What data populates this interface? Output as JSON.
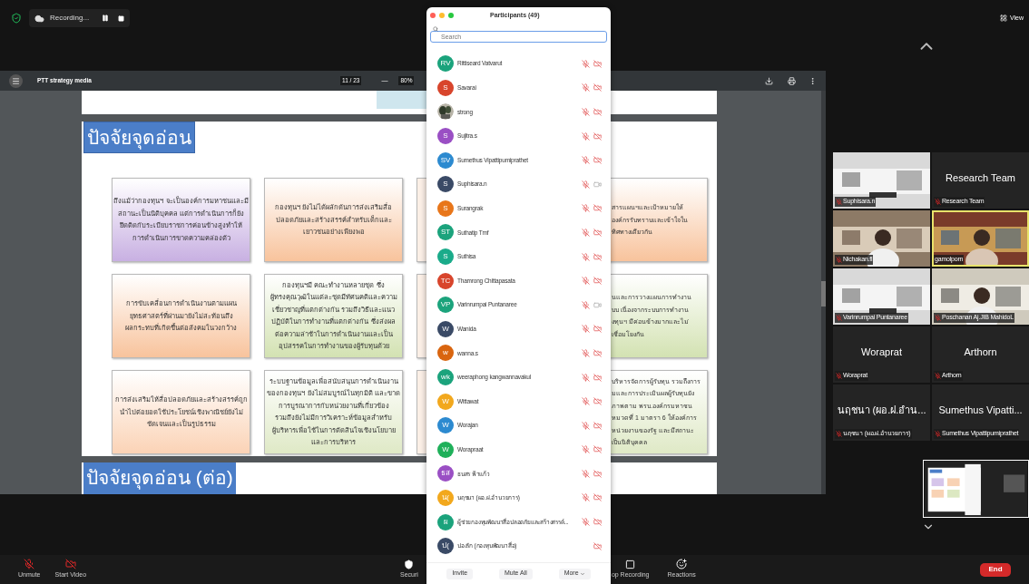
{
  "top_bar": {
    "recording_label": "Recording...",
    "view_label": "View"
  },
  "viewer": {
    "document_title": "PTT strategy media",
    "page_counter": "11 / 23",
    "zoom_out": "—",
    "zoom": "80%"
  },
  "slides": [
    {
      "title": "ปัจจัยจุดอ่อน",
      "cards": [
        {
          "kind": "full",
          "color": "#c8b0e2",
          "lines": [
            "ถึงแม้ว่ากองทุนฯ จะเป็นองค์การมหาชนและมี",
            "สถานะเป็นนิติบุคคล แต่การดำเนินการก็ยัง",
            "ยึดติดกับระเบียบราชการค่อนข้างสูงทำให้",
            "การดำเนินการขาดความคล่องตัว"
          ]
        },
        {
          "kind": "full",
          "color": "#f8c39c",
          "lines": [
            "กองทุนฯ ยังไม่ได้ผลักดันการส่งเสริมสื่อ",
            "ปลอดภัยและสร้างสรรค์สำหรับเด็กและ",
            "เยาวชนอย่างเพียงพอ"
          ]
        },
        {
          "kind": "sliver"
        },
        {
          "kind": "cut",
          "color": "#f8c39c",
          "lines": [
            "สารแผนฯและเป้าหมายให้",
            "องค์กรรับทราบและเข้าใจใน",
            "ทิศทางเดียวกัน"
          ]
        },
        {
          "kind": "full",
          "color": "#f8c39c",
          "lines": [
            "การขับเคลื่อนการดำเนินงานตามแผน",
            "ยุทธศาสตร์ที่ผ่านมายังไม่สะท้อนถึง",
            "ผลกระทบที่เกิดขึ้นต่อสังคมในวงกว้าง"
          ]
        },
        {
          "kind": "full",
          "color": "#d3e2b2",
          "lines": [
            "กองทุนฯมี คณะทำงานหลายชุด ซึ่ง",
            "ผู้ทรงคุณวุฒิในแต่ละชุดมีทัศนคติและความ",
            "เชี่ยวชาญที่แตกต่างกัน รวมถึงวิธีและแนว",
            "ปฏิบัติในการทำงานที่แตกต่างกัน ซึ่งส่งผล",
            "ต่อความล่าช้าในการดำเนินงานและเป็น",
            "อุปสรรคในการทำงานของผู้รับทุนด้วย"
          ]
        },
        {
          "kind": "sliver"
        },
        {
          "kind": "cut",
          "color": "#d3e2b2",
          "lines": [
            "นและการวางแผนการทำงาน",
            "บบ เนื่องจากระบบการทำงาน",
            "งทุนฯ มีค่อนข้างมากและไม่",
            "เชื่อมโยงกัน"
          ]
        },
        {
          "kind": "full",
          "color": "#fbd3b6",
          "lines": [
            "การส่งเสริมให้สื่อปลอดภัยและสร้างสรรค์ถูก",
            "นำไปต่อยอดใช้ประโยชน์เชิงพาณิชย์ยังไม่",
            "ชัดเจนและเป็นรูปธรรม"
          ]
        },
        {
          "kind": "full",
          "color": "#dfe9c6",
          "lines": [
            "ระบบฐานข้อมูลเพื่อสนับสนุนการดำเนินงาน",
            "ของกองทุนฯ ยังไม่สมบูรณ์ในทุกมิติ และขาด",
            "การบูรณาการกับหน่วยงานที่เกี่ยวข้อง",
            "รวมถึงยังไม่มีการวิเคราะห์ข้อมูลสำหรับ",
            "ผู้บริหารเพื่อใช้ในการตัดสินใจเชิงนโยบาย",
            "และการบริหาร"
          ]
        },
        {
          "kind": "sliver"
        },
        {
          "kind": "cut",
          "color": "#dfe9c6",
          "lines": [
            "บริหารจัดการผู้รับทุน รวมถึงการ",
            "มและการประเมินผลผู้รับทุนยัง",
            "ภาพตาม พรบ.องค์กรมหาชน",
            "หมวดที่ 1 มาตรา 6 ให้องค์การ",
            "หน่วยงานของรัฐ และมีสถานะ",
            "เป็นนิติบุคคล"
          ]
        }
      ]
    },
    {
      "title": "ปัจจัยจุดอ่อน (ต่อ)"
    }
  ],
  "participants": {
    "title": "Participants (49)",
    "search_placeholder": "Search",
    "rows": [
      {
        "kind": "initials",
        "initials": "RV",
        "name": "Rittiseard Vatvarut",
        "color": "#1ba37c",
        "mic_muted": true,
        "video_on": false
      },
      {
        "kind": "initials",
        "initials": "S",
        "name": "Savarai",
        "color": "#d8452c",
        "mic_muted": true,
        "video_on": false
      },
      {
        "kind": "picture",
        "name": "strong",
        "mic_muted": true,
        "video_on": false
      },
      {
        "kind": "initials",
        "initials": "S",
        "name": "Sujitra.s",
        "color": "#9a4fc4",
        "mic_muted": true,
        "video_on": false
      },
      {
        "kind": "initials",
        "initials": "SV",
        "name": "Sumethus Vipattipumiprathet",
        "color": "#2c8ad0",
        "mic_muted": true,
        "video_on": false
      },
      {
        "kind": "initials",
        "initials": "S",
        "name": "Suphisara.n",
        "color": "#3a4a66",
        "mic_muted": true,
        "video_on": true
      },
      {
        "kind": "initials",
        "initials": "S",
        "name": "Surangrak",
        "color": "#e8761a",
        "mic_muted": true,
        "video_on": false
      },
      {
        "kind": "initials",
        "initials": "ST",
        "name": "Suthatip Tmf",
        "color": "#1ba37c",
        "mic_muted": true,
        "video_on": false
      },
      {
        "kind": "initials",
        "initials": "S",
        "name": "Suthisa",
        "color": "#1aab8a",
        "mic_muted": true,
        "video_on": false
      },
      {
        "kind": "initials",
        "initials": "TC",
        "name": "Thamrong Chittapasata",
        "color": "#d8452c",
        "mic_muted": true,
        "video_on": false
      },
      {
        "kind": "initials",
        "initials": "VP",
        "name": "Varinrumpai Puntanaree",
        "color": "#1ba37c",
        "mic_muted": true,
        "video_on": true
      },
      {
        "kind": "initials",
        "initials": "W",
        "name": "Wanida",
        "color": "#3a4a66",
        "mic_muted": true,
        "video_on": false
      },
      {
        "kind": "initials",
        "initials": "w",
        "name": "wanna.s",
        "color": "#d9650f",
        "mic_muted": true,
        "video_on": false
      },
      {
        "kind": "initials",
        "initials": "wk",
        "name": "weeraphong kangwannavakul",
        "color": "#1ba37c",
        "mic_muted": true,
        "video_on": false
      },
      {
        "kind": "initials",
        "initials": "W",
        "name": "Wittawat",
        "color": "#f2a81d",
        "mic_muted": true,
        "video_on": false
      },
      {
        "kind": "initials",
        "initials": "W",
        "name": "Worajan",
        "color": "#2c8ad0",
        "mic_muted": true,
        "video_on": false
      },
      {
        "kind": "initials",
        "initials": "W",
        "name": "Worapraat",
        "color": "#1fb05a",
        "mic_muted": true,
        "video_on": false
      },
      {
        "kind": "initials",
        "initials": "ธส",
        "name": "ธนสร ฟ้าแก้ว",
        "color": "#9a4fc4",
        "mic_muted": true,
        "video_on": false
      },
      {
        "kind": "initials",
        "initials": "น(",
        "name": "นฤชนา (ผอ.ฝ.อำนวยการ)",
        "color": "#f2a81d",
        "mic_muted": true,
        "video_on": false
      },
      {
        "kind": "initials",
        "initials": "ผ",
        "name": "ผู้ช่วยกองทุนพัฒนาสื่อปลอดภัยและสร้างสรรค์...",
        "color": "#1ba37c",
        "mic_muted": true,
        "video_on": false
      },
      {
        "kind": "initials",
        "initials": "ป(",
        "name": "ปองรัก (กองทุนพัฒนาสื่อ)",
        "color": "#3a4a66",
        "mic_muted": false,
        "video_on": false
      }
    ],
    "buttons": [
      "Invite",
      "Mute All",
      "More"
    ]
  },
  "gallery": [
    {
      "kind": "video",
      "label": "Suphisara.n",
      "muted": true,
      "active": false
    },
    {
      "kind": "name",
      "display_name": "Research Team",
      "label": "Research Team",
      "muted": true,
      "active": false
    },
    {
      "kind": "video",
      "label": "Nichakan.fl",
      "muted": true,
      "active": false
    },
    {
      "kind": "video",
      "label": "gamolporn",
      "muted": false,
      "active": true
    },
    {
      "kind": "video",
      "label": "Varinrumpai Puntanaree",
      "muted": true,
      "active": false
    },
    {
      "kind": "video",
      "label": "Poschanan Aj.JIB MahidoL",
      "muted": true,
      "active": false
    },
    {
      "kind": "name",
      "display_name": "Woraprat",
      "label": "Woraprat",
      "muted": true,
      "active": false
    },
    {
      "kind": "name",
      "display_name": "Arthorn",
      "label": "Arthorn",
      "muted": true,
      "active": false
    },
    {
      "kind": "name",
      "display_name": "นฤชนา (ผอ.ฝ.อำน...",
      "label": "นฤชนา (ผอ.ฝ.อำนวยการ)",
      "muted": true,
      "active": false
    },
    {
      "kind": "name",
      "display_name": "Sumethus Vipatti...",
      "label": "Sumethus Vipattipumiprathet",
      "muted": true,
      "active": false
    }
  ],
  "toolbar": {
    "items": [
      {
        "kind": "mic",
        "label": "Unmute"
      },
      {
        "kind": "video",
        "label": "Start Video"
      },
      {
        "kind": "security",
        "label": "Securi"
      },
      {
        "kind": "stop",
        "label": "op Recording"
      },
      {
        "kind": "reactions",
        "label": "Reactions"
      }
    ],
    "end_label": "End"
  }
}
